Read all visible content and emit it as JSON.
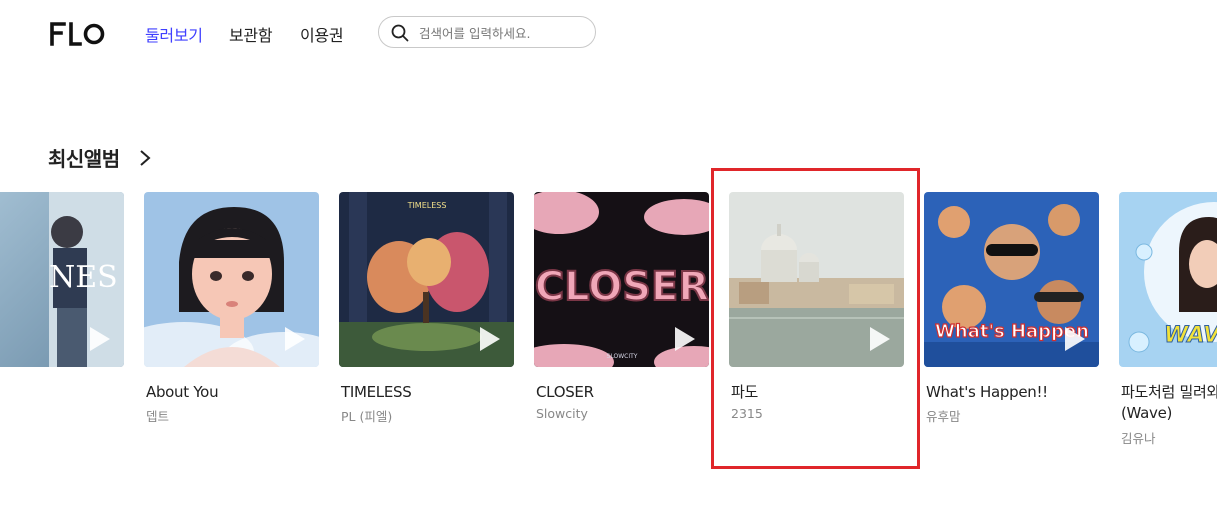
{
  "header": {
    "logo_text": "FLO",
    "nav": [
      "둘러보기",
      "보관함",
      "이용권"
    ],
    "search_placeholder": "검색어를 입력하세요."
  },
  "section": {
    "title": "최신앨범"
  },
  "albums": [
    {
      "title": "",
      "artist": "",
      "cover_text": "NES"
    },
    {
      "title": "About You",
      "artist": "뎁트"
    },
    {
      "title": "TIMELESS",
      "artist": "PL (피엘)",
      "cover_text": "TIMELESS"
    },
    {
      "title": "CLOSER",
      "artist": "Slowcity",
      "cover_text": "CLOSER",
      "cover_subtext": "SLOWCITY"
    },
    {
      "title": "파도",
      "artist": "2315"
    },
    {
      "title": "What's Happen!!",
      "artist": "유후맘",
      "cover_text": "What's Happen"
    },
    {
      "title": "파도처럼 밀려와 (Wave)",
      "artist": "김유나",
      "cover_text": "WAVE"
    }
  ],
  "colors": {
    "accent": "#3f3fff",
    "highlight": "#e0262a"
  }
}
